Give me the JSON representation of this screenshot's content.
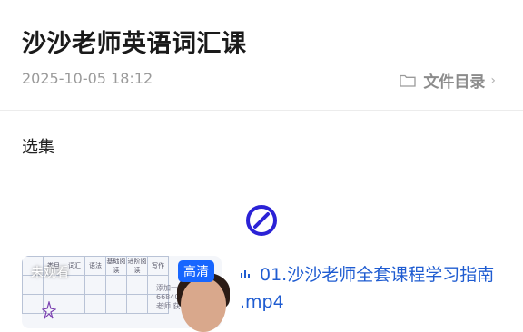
{
  "header": {
    "title": "沙沙老师英语词汇课",
    "date": "2025-10-05  18:12",
    "dir_label": "文件目录",
    "folder_icon": "folder-icon",
    "chevron_icon": "chevron-right-icon"
  },
  "section": {
    "label": "选集"
  },
  "loading": {
    "icon": "loading-spinner-icon",
    "color": "#2b22d6"
  },
  "episode": {
    "watch_status": "未观看",
    "quality": "高清",
    "title": "01.沙沙老师全套课程学习指南 .mp4",
    "playing_icon": "equalizer-icon",
    "thumb_headers": [
      "类目",
      "词汇",
      "语法",
      "基础阅读",
      "进阶阅读",
      "写作"
    ],
    "overlay_text": "添加一下沙沙老师668406 招收代课老师 获取资料"
  },
  "colors": {
    "accent": "#1f5cd1",
    "badge": "#1766ff"
  }
}
